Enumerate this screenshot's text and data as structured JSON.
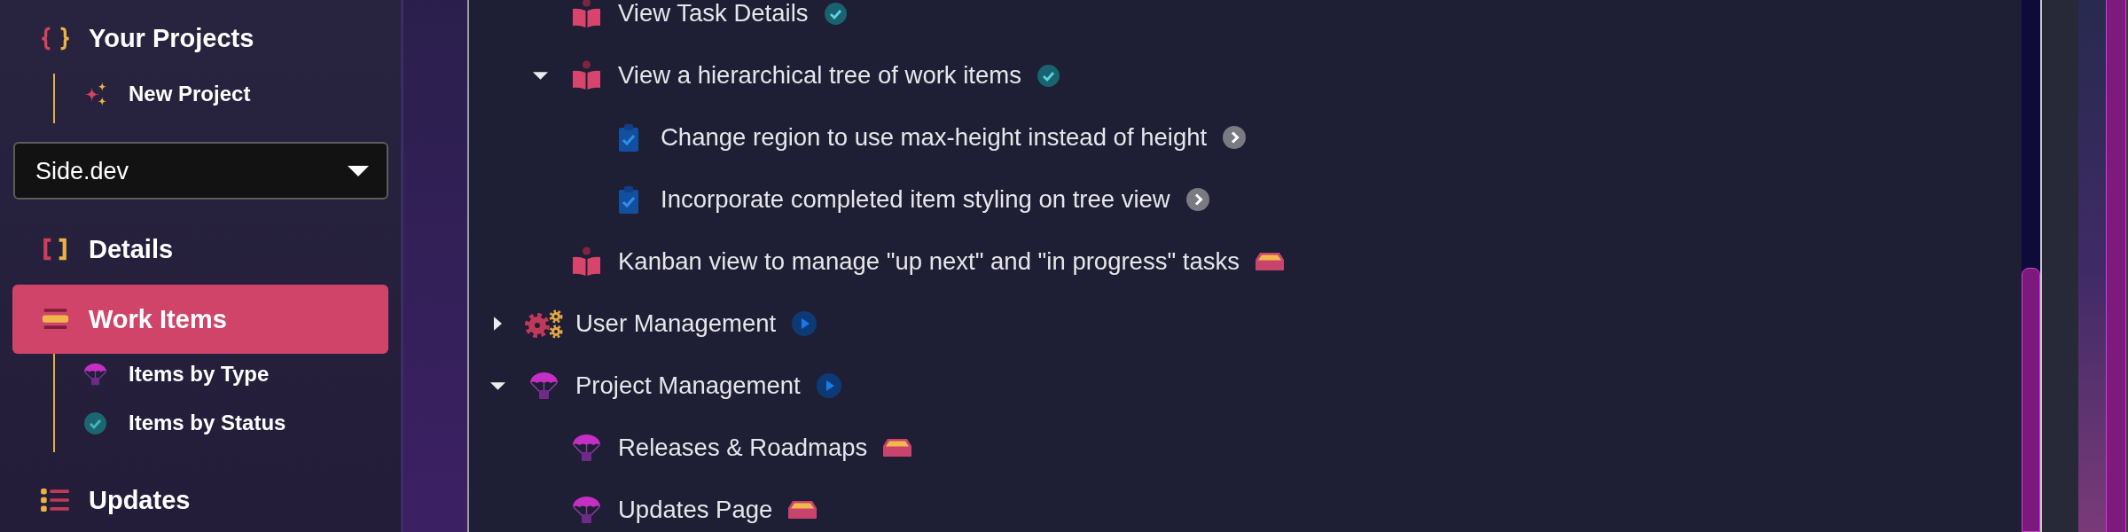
{
  "sidebar": {
    "items": [
      {
        "kind": "link",
        "label": "Your Projects",
        "selected": false,
        "children": [
          {
            "label": "New Project",
            "selected": false
          }
        ]
      },
      {
        "kind": "select",
        "value": "Side.dev"
      },
      {
        "kind": "link",
        "label": "Details",
        "selected": false
      },
      {
        "kind": "link",
        "label": "Work Items",
        "selected": true,
        "children": [
          {
            "label": "Items by Type",
            "selected": false
          },
          {
            "label": "Items by Status",
            "selected": false
          }
        ]
      },
      {
        "kind": "link",
        "label": "Updates",
        "selected": false
      }
    ]
  },
  "tree": [
    {
      "children": [
        {
          "kind": "story",
          "label": "View Task Details",
          "status": {
            "kind": "done"
          }
        },
        {
          "kind": "story",
          "label": "View a hierarchical tree of work items",
          "status": {
            "kind": "done"
          },
          "expanded": true,
          "children": [
            {
              "kind": "task",
              "label": "Change region to use max-height instead of height",
              "status": {
                "kind": "review"
              }
            },
            {
              "kind": "task",
              "label": "Incorporate completed item styling on tree view",
              "status": {
                "kind": "review"
              }
            }
          ]
        },
        {
          "kind": "story",
          "label": "Kanban view to manage \"up next\" and \"in progress\" tasks",
          "status": {
            "kind": "backlog"
          }
        }
      ]
    },
    {
      "kind": "epic",
      "label": "User Management",
      "status": {
        "kind": "active"
      },
      "expanded": false
    },
    {
      "kind": "feature",
      "label": "Project Management",
      "status": {
        "kind": "active"
      },
      "expanded": true,
      "children": [
        {
          "kind": "feature",
          "label": "Releases & Roadmaps",
          "status": {
            "kind": "backlog"
          }
        },
        {
          "kind": "feature",
          "label": "Updates Page",
          "status": {
            "kind": "backlog"
          }
        }
      ]
    }
  ]
}
